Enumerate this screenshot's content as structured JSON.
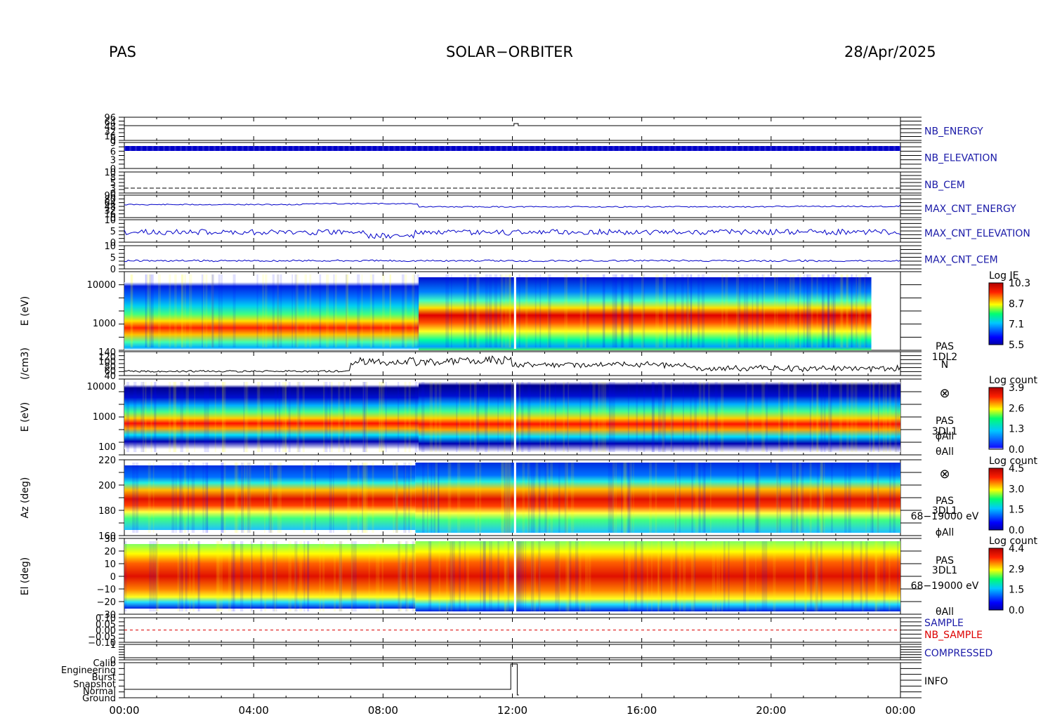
{
  "header": {
    "left": "PAS",
    "center": "SOLAR−ORBITER",
    "right": "28/Apr/2025"
  },
  "colors": {
    "trace_blue": "#0000c8",
    "label_blue": "#1a1aa8",
    "label_red": "#dd0000",
    "trace_black": "#000000"
  },
  "chart_data": {
    "type": "heatmap",
    "time_ticks": [
      "00:00",
      "04:00",
      "08:00",
      "12:00",
      "16:00",
      "20:00",
      "00:00"
    ],
    "time_range_hours": [
      0,
      24
    ],
    "panels": [
      {
        "id": "nb_energy",
        "label": "NB_ENERGY",
        "label_color": "blue",
        "tick_labels": [
          "96",
          "64",
          "48",
          "32",
          "16",
          "0"
        ],
        "kind": "step-line"
      },
      {
        "id": "nb_elevation",
        "label": "NB_ELEVATION",
        "label_color": "blue",
        "tick_labels": [
          "9",
          "6",
          "3",
          "0"
        ],
        "kind": "dense-line"
      },
      {
        "id": "nb_cem",
        "label": "NB_CEM",
        "label_color": "blue",
        "tick_labels": [
          "10",
          "8",
          "5",
          "3",
          "0"
        ],
        "kind": "dashed-line"
      },
      {
        "id": "max_cnt_energy",
        "label": "MAX_CNT_ENERGY",
        "label_color": "blue",
        "tick_labels": [
          "96",
          "80",
          "64",
          "48",
          "32",
          "16",
          "0"
        ],
        "kind": "line"
      },
      {
        "id": "max_cnt_elevation",
        "label": "MAX_CNT_ELEVATION",
        "label_color": "blue",
        "tick_labels": [
          "10",
          "5",
          "0"
        ],
        "kind": "line"
      },
      {
        "id": "max_cnt_cem",
        "label": "MAX_CNT_CEM",
        "label_color": "blue",
        "tick_labels": [
          "10",
          "5",
          "0"
        ],
        "kind": "line"
      },
      {
        "id": "je_spectrogram",
        "ylabel": "E (eV)",
        "tick_labels": [
          "10000",
          "1000"
        ],
        "kind": "spectrogram",
        "colorbar": {
          "title": "Log JE",
          "ticks": [
            "10.3",
            "8.7",
            "7.1",
            "5.5"
          ]
        }
      },
      {
        "id": "density",
        "ylabel": "(/cm3)",
        "tick_labels": [
          "140",
          "120",
          "100",
          "80",
          "60",
          "40"
        ],
        "kind": "line",
        "label_lines": [
          "PAS",
          "1DL2",
          "N"
        ]
      },
      {
        "id": "count_energy",
        "ylabel": "E (eV)",
        "tick_labels": [
          "10000",
          "1000",
          "100"
        ],
        "kind": "spectrogram",
        "colorbar": {
          "title": "Log count",
          "ticks": [
            "3.9",
            "2.6",
            "1.3",
            "0.0"
          ]
        },
        "label_lines": [
          "⊗",
          "PAS",
          "3DL1",
          "ϕAll",
          "θAll"
        ]
      },
      {
        "id": "azimuth",
        "ylabel": "Az (deg)",
        "tick_labels": [
          "220",
          "200",
          "180",
          "160"
        ],
        "kind": "spectrogram",
        "colorbar": {
          "title": "Log count",
          "ticks": [
            "4.5",
            "3.0",
            "1.5",
            "0.0"
          ]
        },
        "label_lines": [
          "⊗",
          "PAS",
          "3DL1",
          "68−19000 eV",
          "ϕAll"
        ]
      },
      {
        "id": "elevation",
        "ylabel": "El (deg)",
        "tick_labels": [
          "30",
          "20",
          "10",
          "0",
          "−10",
          "−20",
          "−30"
        ],
        "kind": "spectrogram",
        "colorbar": {
          "title": "Log count",
          "ticks": [
            "4.4",
            "2.9",
            "1.5",
            "0.0"
          ]
        },
        "label_lines": [
          "PAS",
          "3DL1",
          "68−19000 eV",
          "θAll"
        ]
      },
      {
        "id": "sample",
        "tick_labels": [
          "0.10",
          "0.05",
          "0.00",
          "−0.05",
          "−0.10"
        ],
        "kind": "dashed-line",
        "labels": [
          {
            "text": "SAMPLE",
            "color": "blue"
          },
          {
            "text": "NB_SAMPLE",
            "color": "red"
          }
        ]
      },
      {
        "id": "compressed",
        "label": "COMPRESSED",
        "label_color": "blue",
        "tick_labels": [
          "1",
          "0"
        ],
        "kind": "line"
      },
      {
        "id": "info",
        "label": "INFO",
        "label_color": "black",
        "tick_labels": [
          "Calib",
          "Engineering",
          "Burst",
          "Snapshot",
          "Normal",
          "Ground"
        ],
        "kind": "step-line"
      }
    ]
  }
}
